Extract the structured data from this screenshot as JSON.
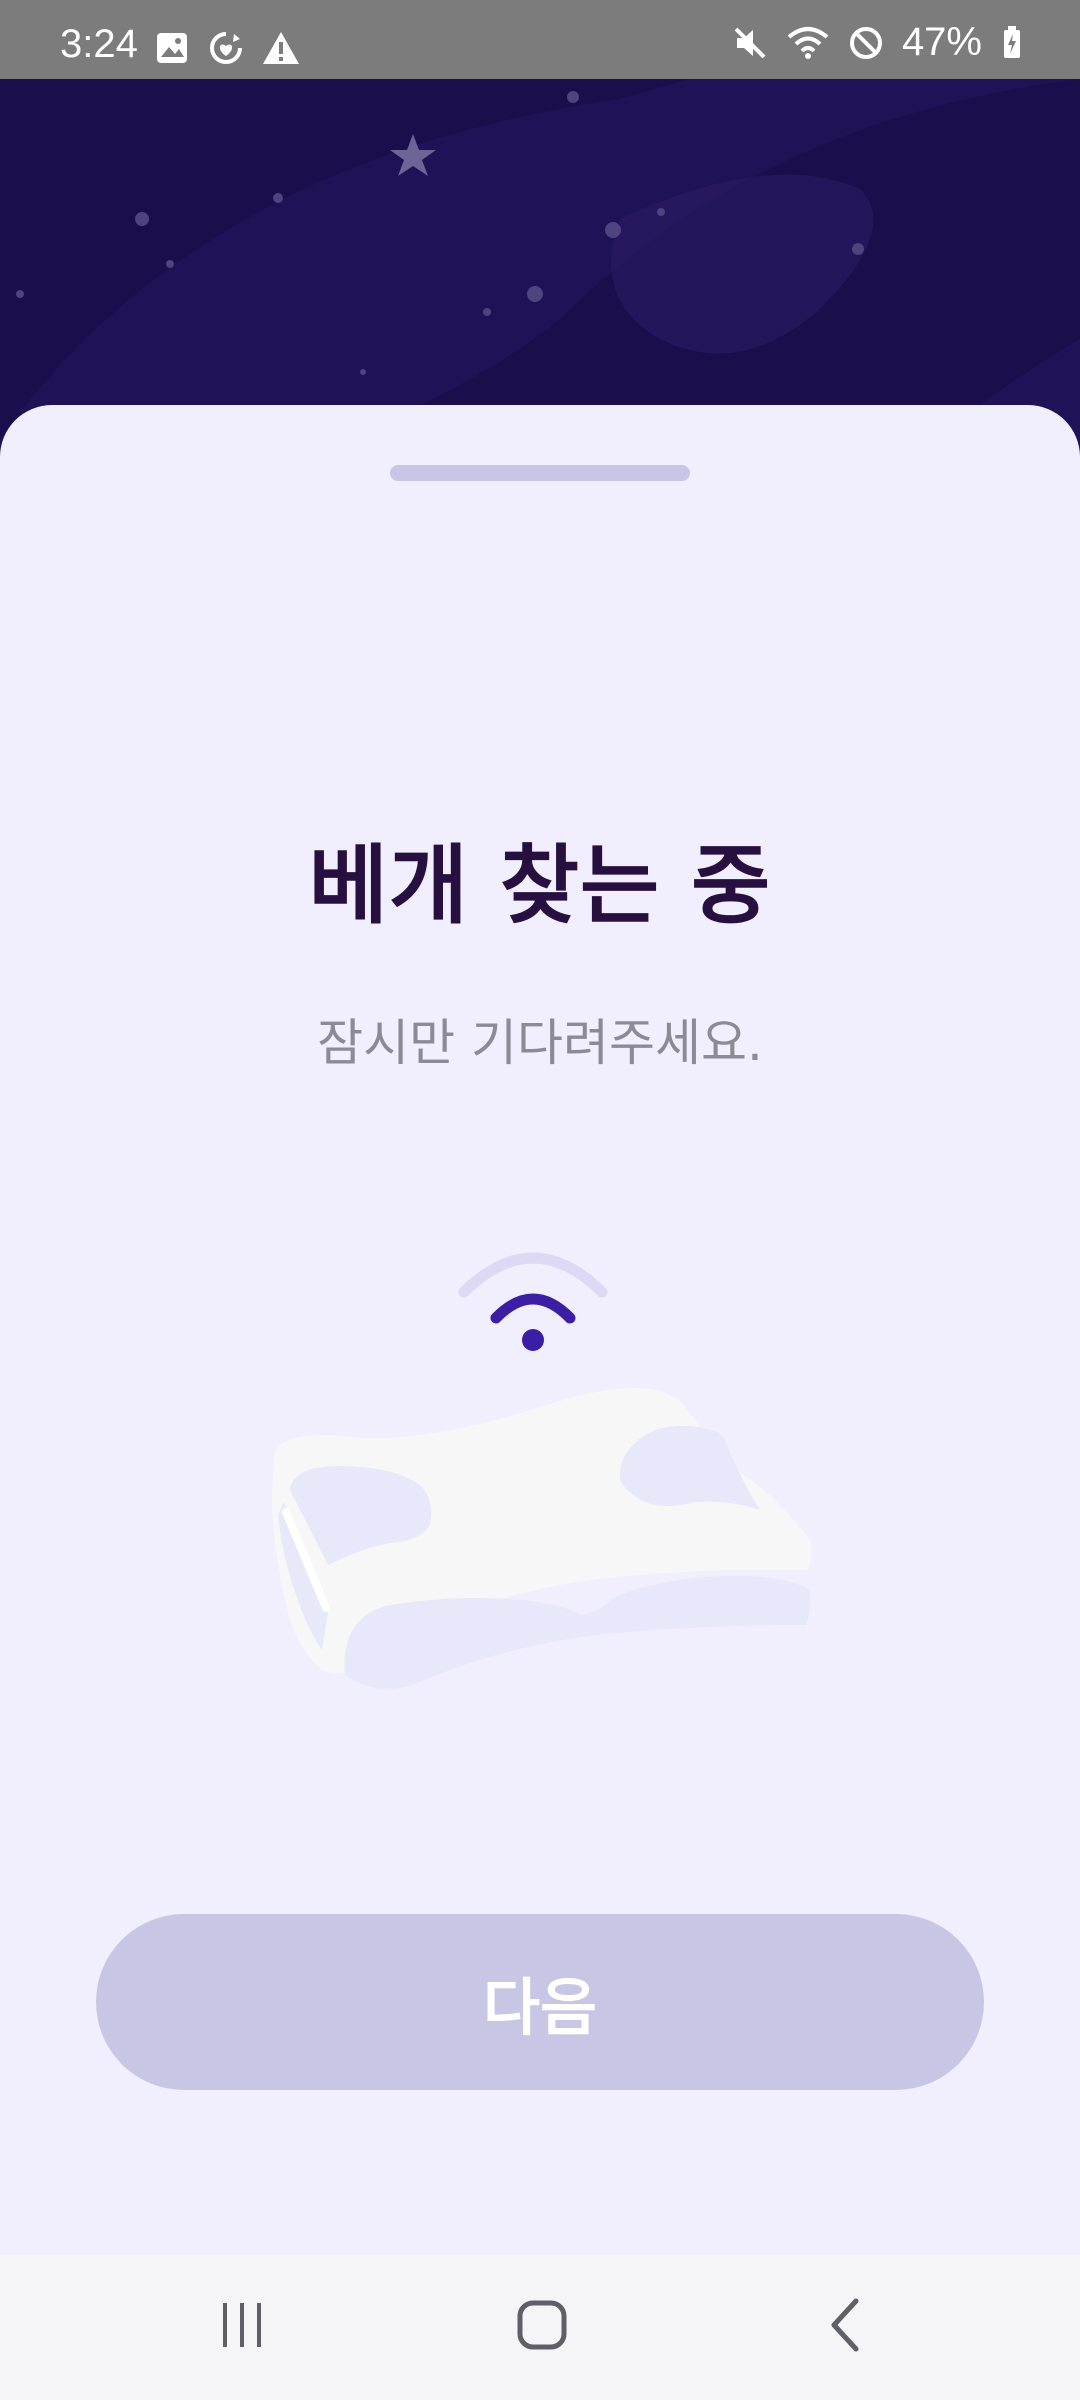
{
  "status_bar": {
    "time": "3:24",
    "battery_percent": "47%",
    "left_icons": [
      "image-icon",
      "sync-heart-icon",
      "warning-icon"
    ],
    "right_icons": [
      "mute-icon",
      "wifi-icon",
      "do-not-disturb-icon",
      "battery-charging-icon"
    ]
  },
  "screen": {
    "title": "베개 찾는 중",
    "subtitle": "잠시만 기다려주세요."
  },
  "illustration": {
    "signal_icon": "wifi-signal-icon",
    "object_icon": "pillow-icon"
  },
  "actions": {
    "next_label": "다음"
  },
  "navigation": {
    "items": [
      "recent-apps-icon",
      "home-icon",
      "back-icon"
    ]
  },
  "colors": {
    "status_bar": "#7c7c7c",
    "hero_background": "#1a0e4c",
    "sheet_background": "#f1effd",
    "title": "#27103f",
    "subtitle": "#8c8a95",
    "button_disabled": "#c7c7e5",
    "accent_signal": "#3b1ea3"
  }
}
